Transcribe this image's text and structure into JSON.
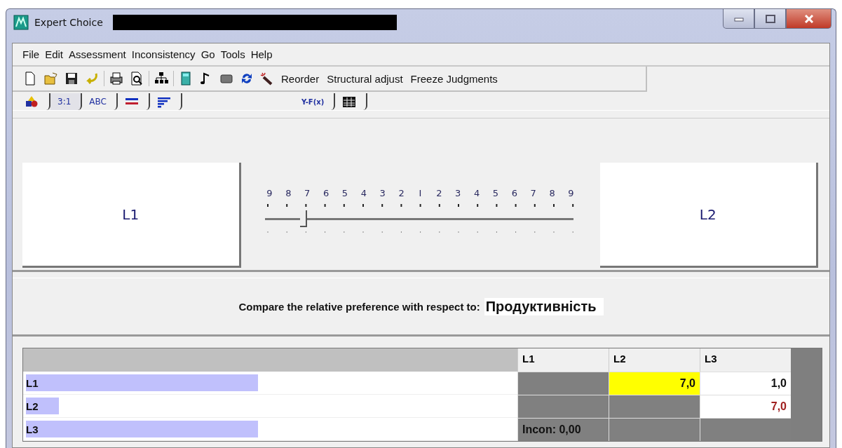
{
  "window": {
    "title": "Expert Choice"
  },
  "menu": [
    "File",
    "Edit",
    "Assessment",
    "Inconsistency",
    "Go",
    "Tools",
    "Help"
  ],
  "toolbar": {
    "commands": [
      "Reorder",
      "Structural adjust",
      "Freeze Judgments"
    ]
  },
  "tabs": [
    {
      "kind": "shapes",
      "selected": false
    },
    {
      "kind": "text",
      "label": "3:1",
      "selected": true
    },
    {
      "kind": "text",
      "label": "ABC",
      "selected": false
    },
    {
      "kind": "lines",
      "selected": false
    },
    {
      "kind": "bars",
      "selected": false
    },
    {
      "kind": "text",
      "label": "Y-F(x)",
      "selected": false,
      "gap": true
    },
    {
      "kind": "table",
      "selected": false
    }
  ],
  "comparison": {
    "left": "L1",
    "right": "L2",
    "scale": [
      "9",
      "8",
      "7",
      "6",
      "5",
      "4",
      "3",
      "2",
      "I",
      "2",
      "3",
      "4",
      "5",
      "6",
      "7",
      "8",
      "9"
    ],
    "level": 0.125
  },
  "message": {
    "prompt": "Compare the relative preference  with respect to:",
    "goal": "Продуктивність"
  },
  "matrix": {
    "columns": [
      "L1",
      "L2",
      "L3"
    ],
    "rows": [
      {
        "name": "L1",
        "level": 0.47,
        "cells": [
          {
            "kind": "blank"
          },
          {
            "kind": "value",
            "text": "7,0",
            "selected": true,
            "inverted": false
          },
          {
            "kind": "value",
            "text": "1,0",
            "selected": false,
            "inverted": false
          }
        ]
      },
      {
        "name": "L2",
        "level": 0.067,
        "cells": [
          {
            "kind": "blank"
          },
          {
            "kind": "blank"
          },
          {
            "kind": "value",
            "text": "7,0",
            "selected": false,
            "inverted": true
          }
        ]
      },
      {
        "name": "L3",
        "level": 0.47,
        "cells": [
          {
            "kind": "note",
            "text": "Incon: 0,00"
          },
          {
            "kind": "blank"
          },
          {
            "kind": "blank"
          }
        ]
      }
    ]
  }
}
